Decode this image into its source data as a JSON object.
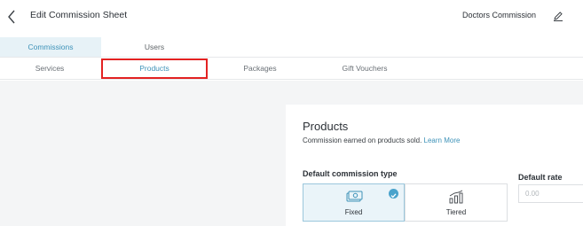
{
  "header": {
    "title": "Edit Commission Sheet",
    "sheet_name": "Doctors Commission",
    "back_icon": "chevron-left-icon",
    "edit_icon": "pencil-icon"
  },
  "primary_tabs": [
    {
      "label": "Commissions",
      "active": true
    },
    {
      "label": "Users",
      "active": false
    }
  ],
  "secondary_tabs": [
    {
      "label": "Services",
      "active": false
    },
    {
      "label": "Products",
      "active": true
    },
    {
      "label": "Packages",
      "active": false
    },
    {
      "label": "Gift Vouchers",
      "active": false
    }
  ],
  "section": {
    "title": "Products",
    "description": "Commission earned on products sold.",
    "learn_more": "Learn More"
  },
  "commission_type": {
    "label": "Default commission type",
    "options": [
      {
        "label": "Fixed",
        "selected": true,
        "icon": "cash-icon"
      },
      {
        "label": "Tiered",
        "selected": false,
        "icon": "bar-chart-icon"
      }
    ]
  },
  "default_rate": {
    "label": "Default rate",
    "placeholder": "0.00"
  },
  "colors": {
    "accent": "#3d92b8",
    "highlight_box": "#e32222"
  }
}
